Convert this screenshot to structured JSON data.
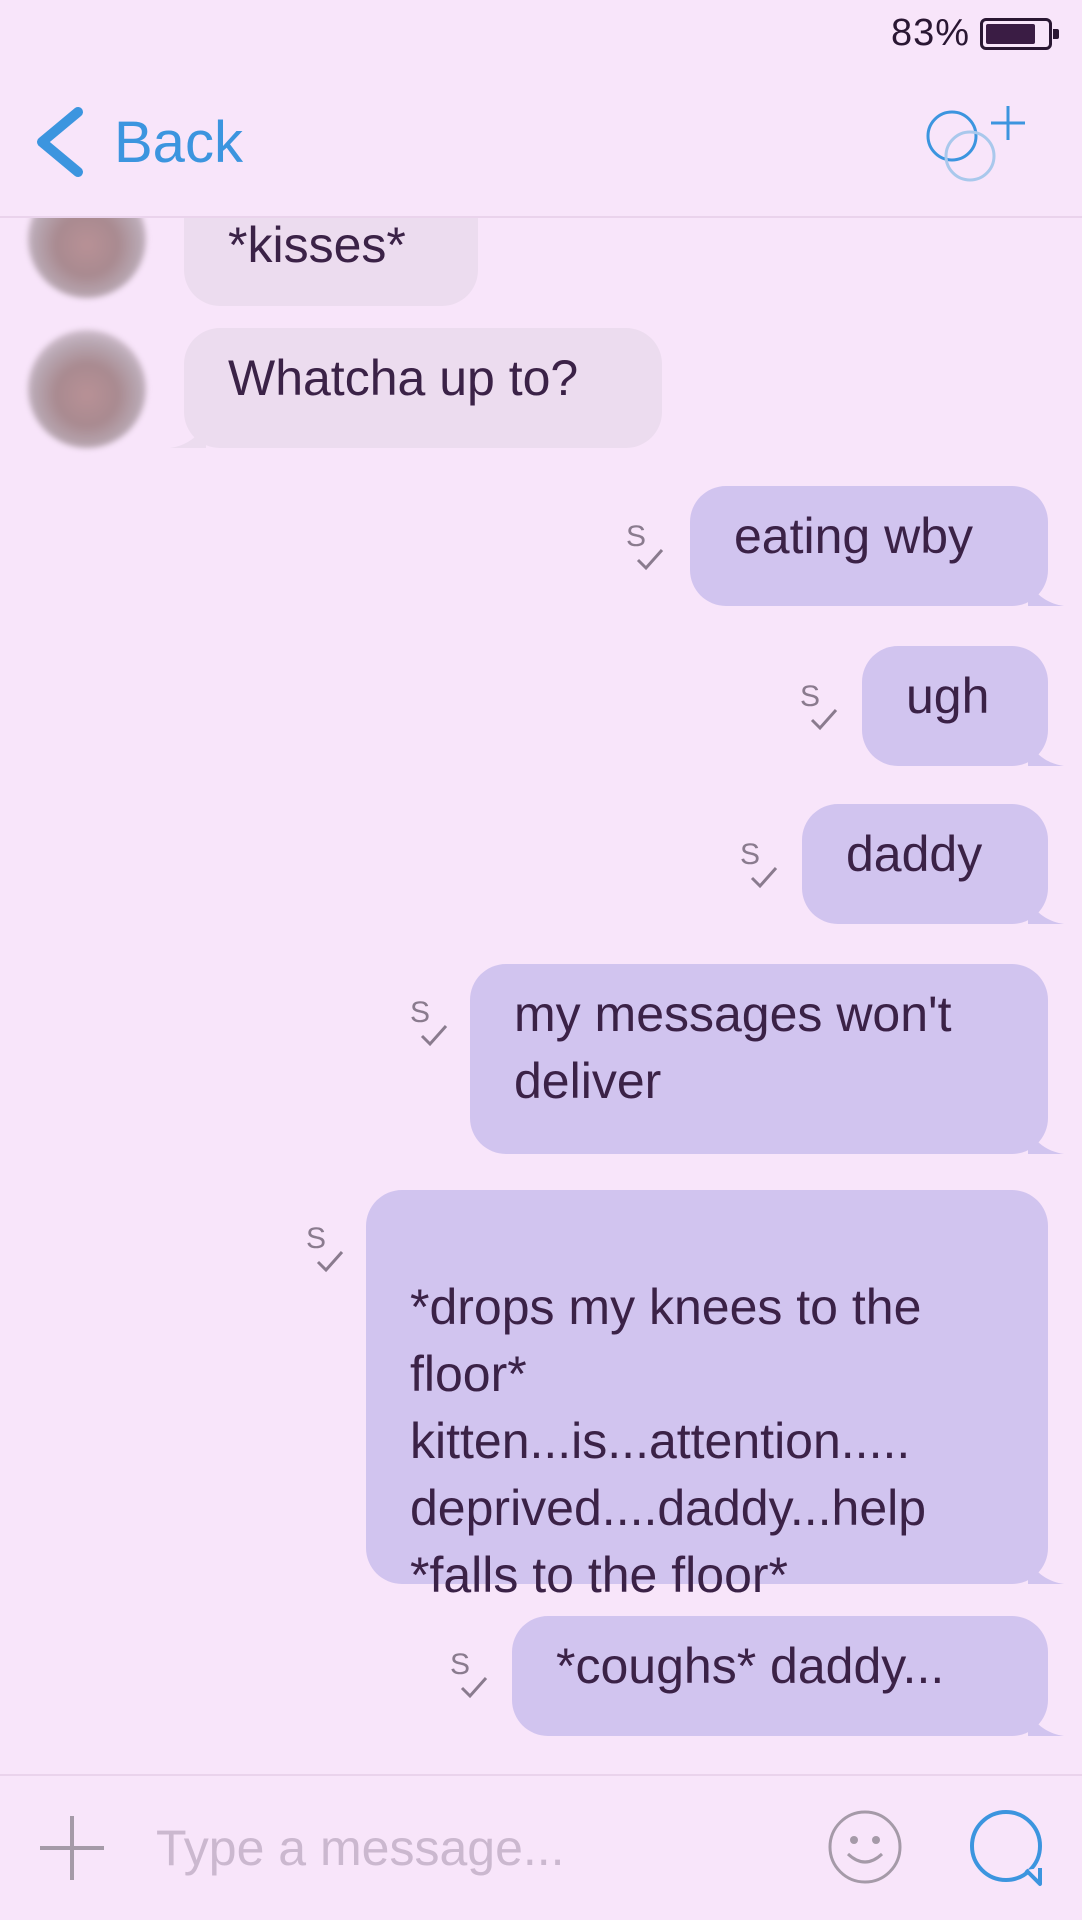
{
  "status_bar": {
    "battery_percent": "83%",
    "battery_level": 0.83
  },
  "nav": {
    "back_label": "Back",
    "icon": "add-contact-icon"
  },
  "messages": [
    {
      "direction": "in",
      "text": "*kisses*",
      "avatar": "blurred-avatar"
    },
    {
      "direction": "in",
      "text": "Whatcha up to?",
      "avatar": "blurred-avatar"
    },
    {
      "direction": "out",
      "text": "eating wby",
      "status": "sent"
    },
    {
      "direction": "out",
      "text": "ugh",
      "status": "sent"
    },
    {
      "direction": "out",
      "text": "daddy",
      "status": "sent"
    },
    {
      "direction": "out",
      "text": "my messages won't deliver",
      "status": "sent"
    },
    {
      "direction": "out",
      "text": "*drops my knees to the floor*\nkitten...is...attention.....\ndeprived....daddy...help\n*falls to the floor*",
      "status": "sent"
    },
    {
      "direction": "out",
      "text": "*coughs* daddy...",
      "status": "sent"
    }
  ],
  "status_mark": "S",
  "composer": {
    "placeholder": "Type a message...",
    "value": "",
    "icons": {
      "attach": "plus-icon",
      "emoji": "emoji-icon",
      "send": "send-icon"
    }
  },
  "colors": {
    "background": "#f8e5fa",
    "accent": "#3c95df",
    "incoming_bubble": "#ecdcef",
    "outgoing_bubble": "#d1c4ef",
    "text": "#3b2247"
  }
}
